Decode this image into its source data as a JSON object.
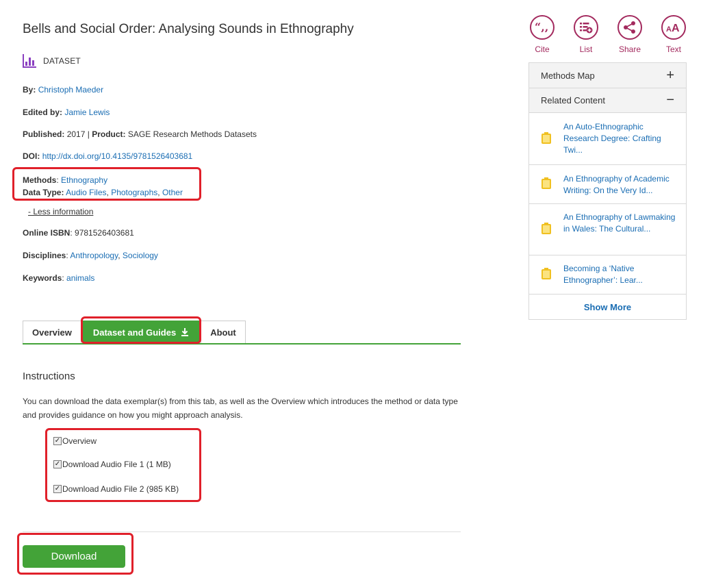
{
  "page": {
    "title": "Bells and Social Order: Analysing Sounds in Ethnography",
    "type": "DATASET"
  },
  "meta": {
    "by_label": "By:",
    "by_value": "Christoph Maeder",
    "edited_label": "Edited by:",
    "edited_value": "Jamie Lewis",
    "published_label": "Published:",
    "published_value": "2017",
    "sep": "|",
    "product_label": "Product:",
    "product_value": "SAGE Research Methods Datasets",
    "doi_label": "DOI:",
    "doi_value": "http://dx.doi.org/10.4135/9781526403681",
    "methods_label": "Methods",
    "methods_value": "Ethnography",
    "datatype_label": "Data Type:",
    "datatype_values": [
      "Audio Files",
      "Photographs",
      "Other"
    ],
    "less_info": "- Less information",
    "isbn_label": "Online ISBN",
    "isbn_value": "9781526403681",
    "disciplines_label": "Disciplines",
    "disciplines_values": [
      "Anthropology",
      "Sociology"
    ],
    "keywords_label": "Keywords",
    "keywords_value": "animals",
    "colon": ":",
    "comma": ","
  },
  "tabs": [
    {
      "label": "Overview"
    },
    {
      "label": "Dataset and Guides",
      "icon": "download-icon"
    },
    {
      "label": "About"
    }
  ],
  "instructions": {
    "title": "Instructions",
    "text": "You can download the data exemplar(s) from this tab, as well as the Overview which introduces the method or data type and provides guidance on how you might approach analysis.",
    "items": [
      {
        "label": "Overview",
        "checked": true
      },
      {
        "label": "Download Audio File 1 (1 MB)",
        "checked": true
      },
      {
        "label": "Download Audio File 2 (985 KB)",
        "checked": true
      }
    ],
    "download_label": "Download"
  },
  "tools": [
    {
      "label": "Cite",
      "icon": "quote-icon"
    },
    {
      "label": "List",
      "icon": "list-add-icon"
    },
    {
      "label": "Share",
      "icon": "share-icon"
    },
    {
      "label": "Text",
      "icon": "text-size-icon"
    }
  ],
  "sidebar": {
    "methods_map": "Methods Map",
    "related_content": "Related Content",
    "related": [
      {
        "title": "An Auto-Ethnographic Research Degree: Crafting Twi..."
      },
      {
        "title": "An Ethnography of Academic Writing: On the Very Id..."
      },
      {
        "title": "An Ethnography of Lawmaking in Wales: The Cultural..."
      },
      {
        "title": "Becoming a ‘Native Ethnographer’: Lear..."
      }
    ],
    "show_more": "Show More"
  },
  "colors": {
    "accent_green": "#43a338",
    "tool_magenta": "#a32a5e",
    "link_blue": "#1a6db3",
    "highlight_red": "#e0202a",
    "dataset_purple": "#8a3fc0"
  }
}
